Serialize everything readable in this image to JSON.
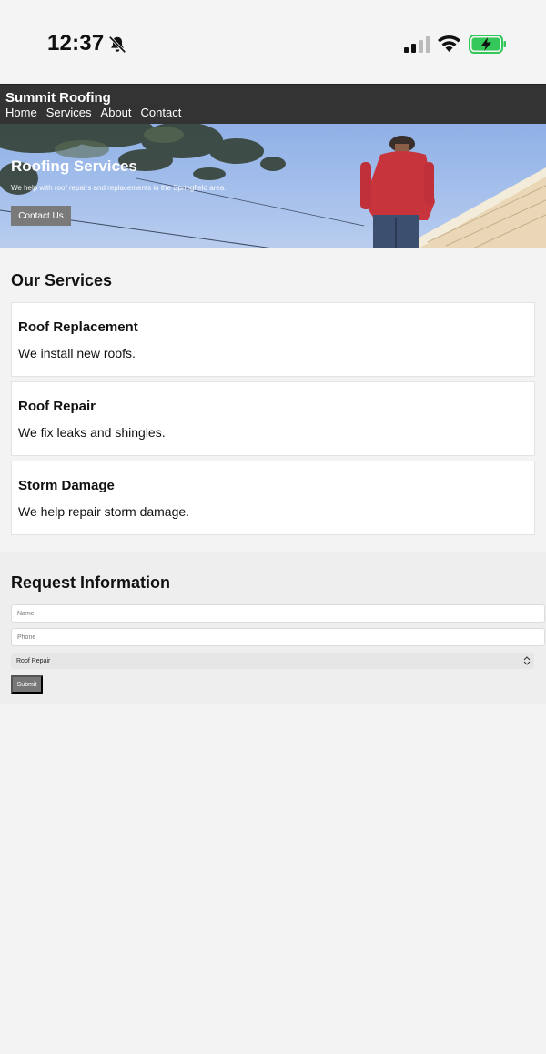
{
  "status_bar": {
    "time": "12:37",
    "icons": [
      "bell-muted-icon",
      "cellular-signal-icon",
      "wifi-icon",
      "battery-charging-icon"
    ],
    "battery_color": "#34c759"
  },
  "header": {
    "brand": "Summit Roofing",
    "nav": [
      "Home",
      "Services",
      "About",
      "Contact"
    ]
  },
  "hero": {
    "title": "Roofing Services",
    "subtitle": "We help with roof repairs and replacements in the Springfield area.",
    "cta_label": "Contact Us"
  },
  "services": {
    "title": "Our Services",
    "items": [
      {
        "name": "Roof Replacement",
        "desc": "We install new roofs."
      },
      {
        "name": "Roof Repair",
        "desc": "We fix leaks and shingles."
      },
      {
        "name": "Storm Damage",
        "desc": "We help repair storm damage."
      }
    ]
  },
  "form": {
    "title": "Request Information",
    "name_placeholder": "Name",
    "phone_placeholder": "Phone",
    "service_selected": "Roof Repair",
    "submit_label": "Submit"
  },
  "colors": {
    "header_bg": "#333333",
    "button_bg": "#7a7a7a",
    "page_bg": "#f3f3f3"
  }
}
